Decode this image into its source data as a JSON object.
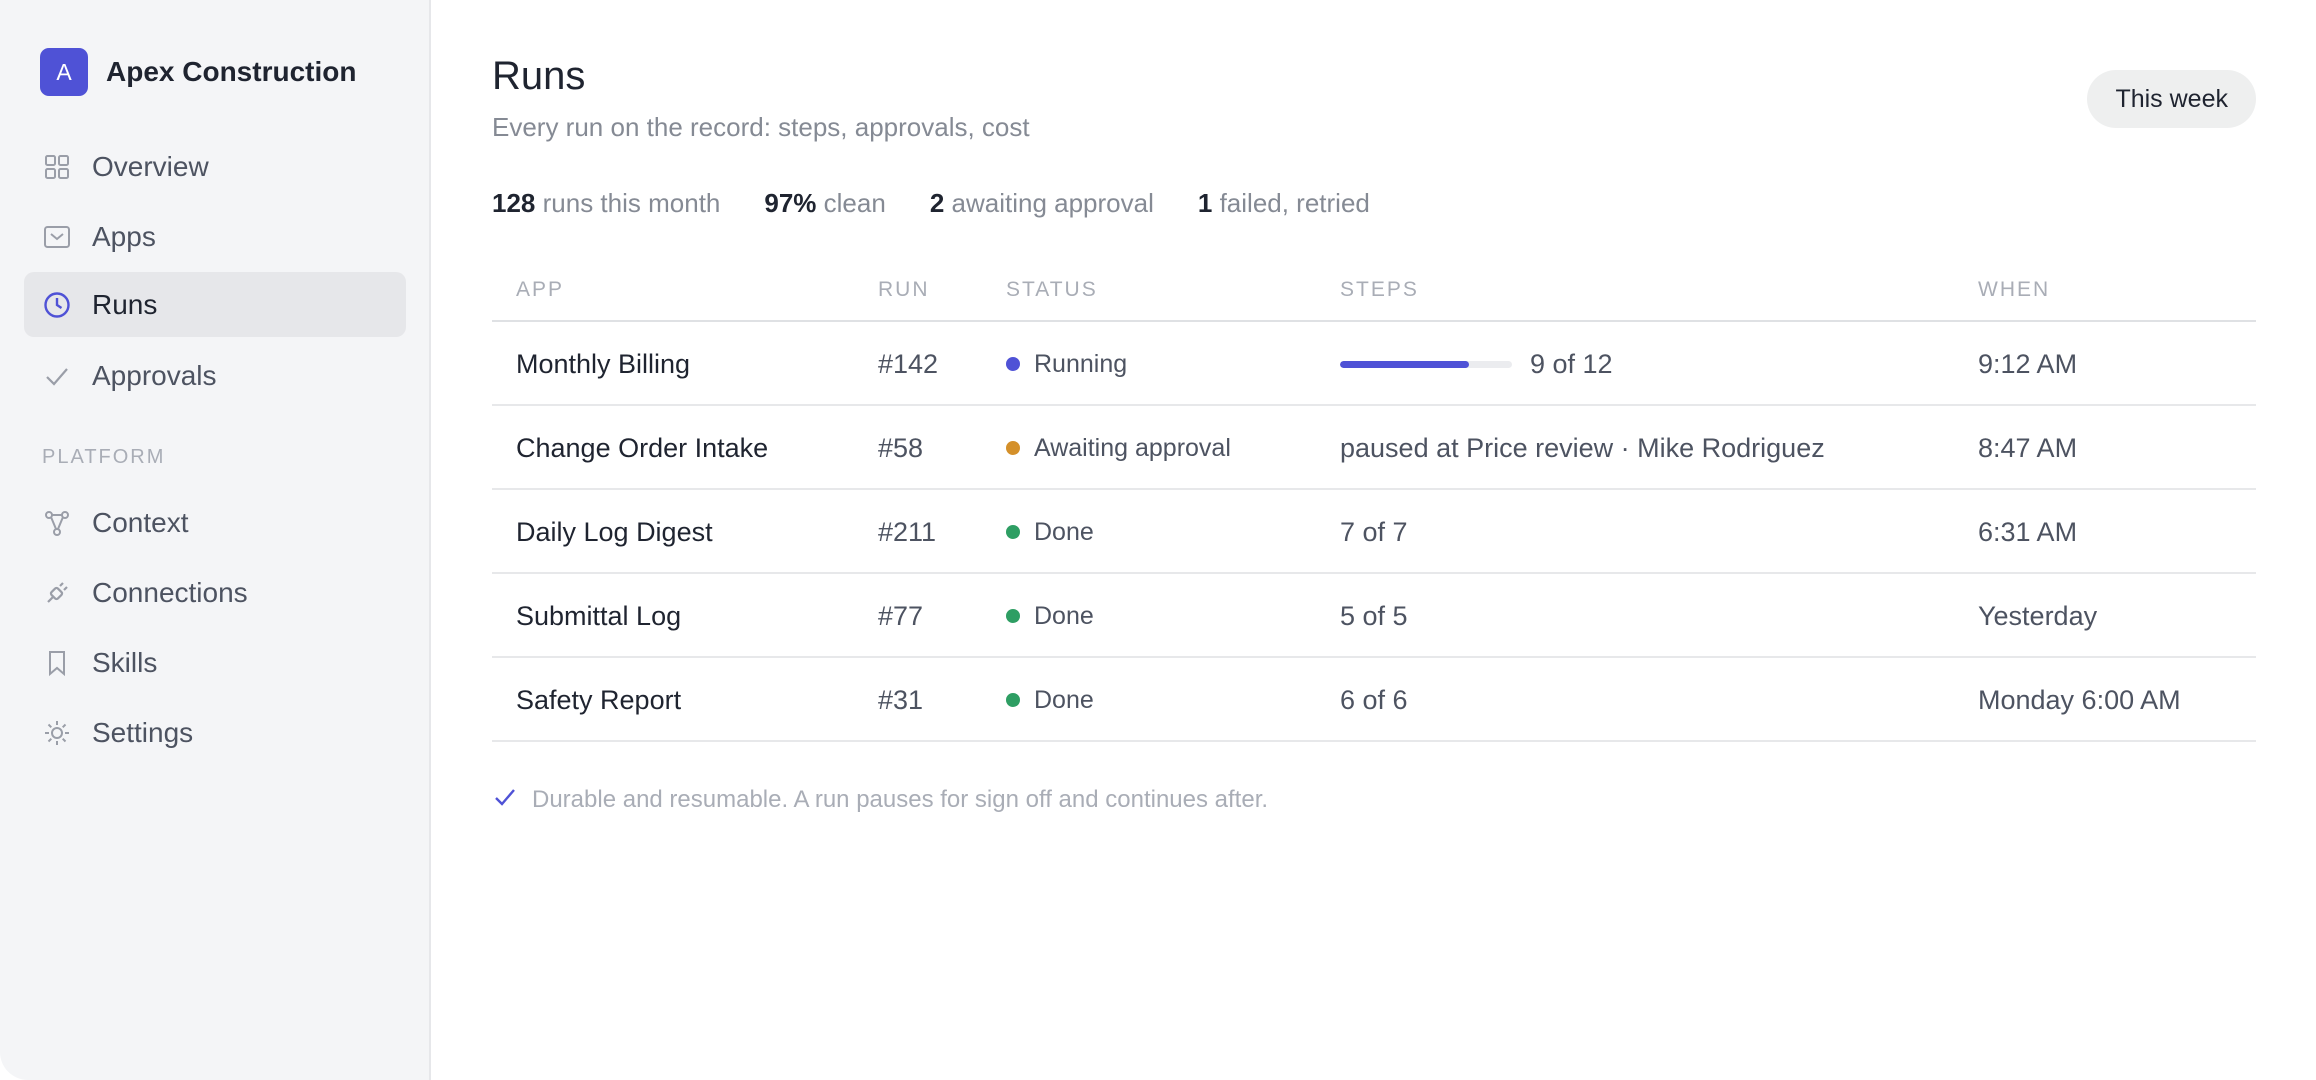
{
  "brand": {
    "initial": "A",
    "name": "Apex Construction",
    "accent": "#4f52d6"
  },
  "sidebar": {
    "items": [
      {
        "label": "Overview",
        "icon": "grid-icon"
      },
      {
        "label": "Apps",
        "icon": "inbox-icon"
      },
      {
        "label": "Runs",
        "icon": "clock-icon",
        "active": true
      },
      {
        "label": "Approvals",
        "icon": "check-icon"
      }
    ],
    "section_label": "PLATFORM",
    "platform_items": [
      {
        "label": "Context",
        "icon": "branch-icon"
      },
      {
        "label": "Connections",
        "icon": "plug-icon"
      },
      {
        "label": "Skills",
        "icon": "bookmark-icon"
      },
      {
        "label": "Settings",
        "icon": "gear-icon"
      }
    ]
  },
  "header": {
    "title": "Runs",
    "subtitle": "Every run on the record: steps, approvals, cost",
    "range_label": "This week"
  },
  "stats": [
    {
      "value": "128",
      "label": "runs this month"
    },
    {
      "value": "97%",
      "label": "clean"
    },
    {
      "value": "2",
      "label": "awaiting approval"
    },
    {
      "value": "1",
      "label": "failed, retried"
    }
  ],
  "table": {
    "columns": [
      "APP",
      "RUN",
      "STATUS",
      "STEPS",
      "WHEN"
    ],
    "rows": [
      {
        "app": "Monthly Billing",
        "run": "#142",
        "status": "Running",
        "status_color": "#4f52d6",
        "steps": "9 of 12",
        "progress": 0.75,
        "when": "9:12 AM"
      },
      {
        "app": "Change Order Intake",
        "run": "#58",
        "status": "Awaiting approval",
        "status_color": "#d4902a",
        "steps": "paused at Price review · Mike Rodriguez",
        "when": "8:47 AM"
      },
      {
        "app": "Daily Log Digest",
        "run": "#211",
        "status": "Done",
        "status_color": "#2e9e63",
        "steps": "7 of 7",
        "when": "6:31 AM"
      },
      {
        "app": "Submittal Log",
        "run": "#77",
        "status": "Done",
        "status_color": "#2e9e63",
        "steps": "5 of 5",
        "when": "Yesterday"
      },
      {
        "app": "Safety Report",
        "run": "#31",
        "status": "Done",
        "status_color": "#2e9e63",
        "steps": "6 of 6",
        "when": "Monday 6:00 AM"
      }
    ]
  },
  "footnote": "Durable and resumable. A run pauses for sign off and continues after."
}
